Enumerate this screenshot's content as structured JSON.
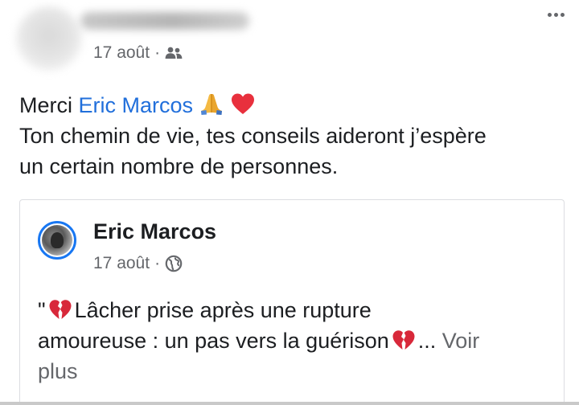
{
  "post": {
    "timestamp": "17 août",
    "separator": "·",
    "audience_icon": "friends-icon",
    "menu_icon": "more-horizontal-icon",
    "text": {
      "line1_prefix": "Merci ",
      "mention": "Eric Marcos",
      "emoji_1": "praying-hands-emoji",
      "emoji_2": "red-heart-emoji",
      "line2": "Ton chemin de vie, tes conseils aideront j’espère",
      "line3": "un certain nombre de personnes."
    }
  },
  "shared_post": {
    "author": "Eric Marcos",
    "timestamp": "17 août",
    "separator": "·",
    "audience_icon": "globe-icon",
    "text": {
      "open_quote": "\"",
      "emoji": "broken-heart-emoji",
      "line1": "Lâcher prise après une rupture",
      "line2": "amoureuse : un pas vers la guérison",
      "ellipsis": "...",
      "see_more_1": " Voir",
      "see_more_2": "plus"
    }
  },
  "colors": {
    "link": "#216fdb",
    "secondary_text": "#65676b",
    "avatar_ring": "#1877f2",
    "heart": "#e8303d"
  }
}
